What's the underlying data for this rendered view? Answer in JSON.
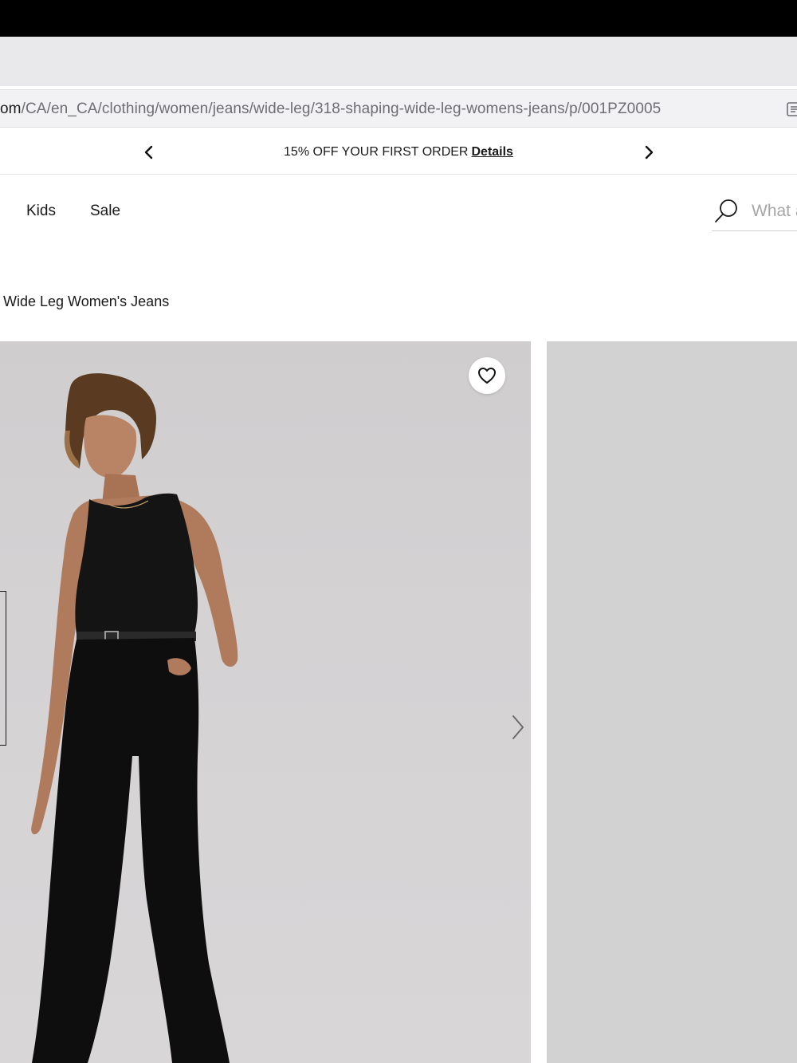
{
  "browser": {
    "url_host": "om",
    "url_path": "/CA/en_CA/clothing/women/jeans/wide-leg/318-shaping-wide-leg-womens-jeans/p/001PZ0005"
  },
  "promo": {
    "text": "15% OFF YOUR FIRST ORDER",
    "details_label": "Details"
  },
  "nav": {
    "items": [
      {
        "label": "Kids"
      },
      {
        "label": "Sale"
      }
    ]
  },
  "search": {
    "placeholder": "What are you looking for?"
  },
  "product": {
    "title_fragment": "Wide Leg Women's Jeans"
  },
  "colors": {
    "image_bg": "#d2d0d1",
    "text": "#1a1a1a"
  },
  "icons": [
    "reader-icon",
    "chevron-left-icon",
    "chevron-right-icon",
    "search-icon",
    "heart-icon"
  ]
}
